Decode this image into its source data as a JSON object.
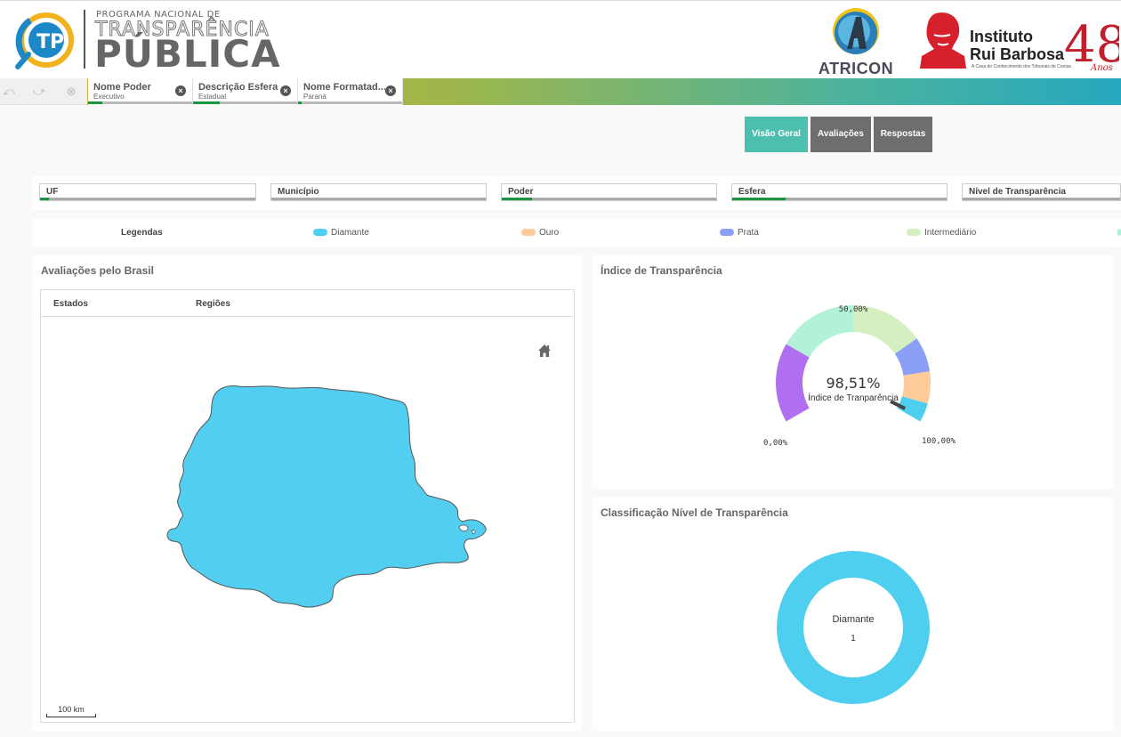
{
  "header": {
    "brand_small": "PROGRAMA NACIONAL DE",
    "brand_trans": "TRANSPARÊNCIA",
    "brand_pub": "PÚBLICA",
    "atricon": "ATRICON",
    "irb_line1": "Instituto",
    "irb_line2": "Rui Barbosa",
    "irb_tagline": "A Casa do Conhecimento dos Tribunais de Contas"
  },
  "selections": [
    {
      "title": "Nome Poder",
      "value": "Executivo"
    },
    {
      "title": "Descrição Esfera",
      "value": "Estadual"
    },
    {
      "title": "Nome Formatad...",
      "value": "Paraná"
    }
  ],
  "nav": {
    "overview": "Visão Geral",
    "evaluations": "Avaliações",
    "answers": "Respostas"
  },
  "filters": [
    "UF",
    "Município",
    "Poder",
    "Esfera",
    "Nível de Transparência"
  ],
  "legend": {
    "title": "Legendas",
    "items": [
      {
        "label": "Diamante",
        "color": "#4fcfef"
      },
      {
        "label": "Ouro",
        "color": "#ffcb9a"
      },
      {
        "label": "Prata",
        "color": "#8a9ff5"
      },
      {
        "label": "Intermediário",
        "color": "#d4f0c0"
      }
    ]
  },
  "map_panel": {
    "title": "Avaliações pelo Brasil",
    "tab_states": "Estados",
    "tab_regions": "Regiões",
    "scale": "100 km",
    "region_color": "#52cff0"
  },
  "index_panel": {
    "title": "Índice de Transparência",
    "value_text": "98,51%",
    "subtitle": "Índice de Tranparência",
    "label_min": "0,00%",
    "label_mid": "50,00%",
    "label_max": "100,00%",
    "value": 98.51
  },
  "class_panel": {
    "title": "Classificação Nível de Transparência",
    "center_label": "Diamante",
    "center_count": "1"
  },
  "chart_data": [
    {
      "type": "gauge",
      "title": "Índice de Transparência",
      "value": 98.51,
      "range": [
        0,
        100
      ],
      "bands": [
        {
          "color": "#b06ef0"
        },
        {
          "color": "#b2f2d8"
        },
        {
          "color": "#d4f0c0"
        },
        {
          "color": "#8a9ff5"
        },
        {
          "color": "#ffcb9a"
        },
        {
          "color": "#4fcfef"
        }
      ]
    },
    {
      "type": "pie",
      "title": "Classificação Nível de Transparência",
      "categories": [
        "Diamante"
      ],
      "values": [
        1
      ],
      "colors": [
        "#4fcfef"
      ]
    }
  ]
}
